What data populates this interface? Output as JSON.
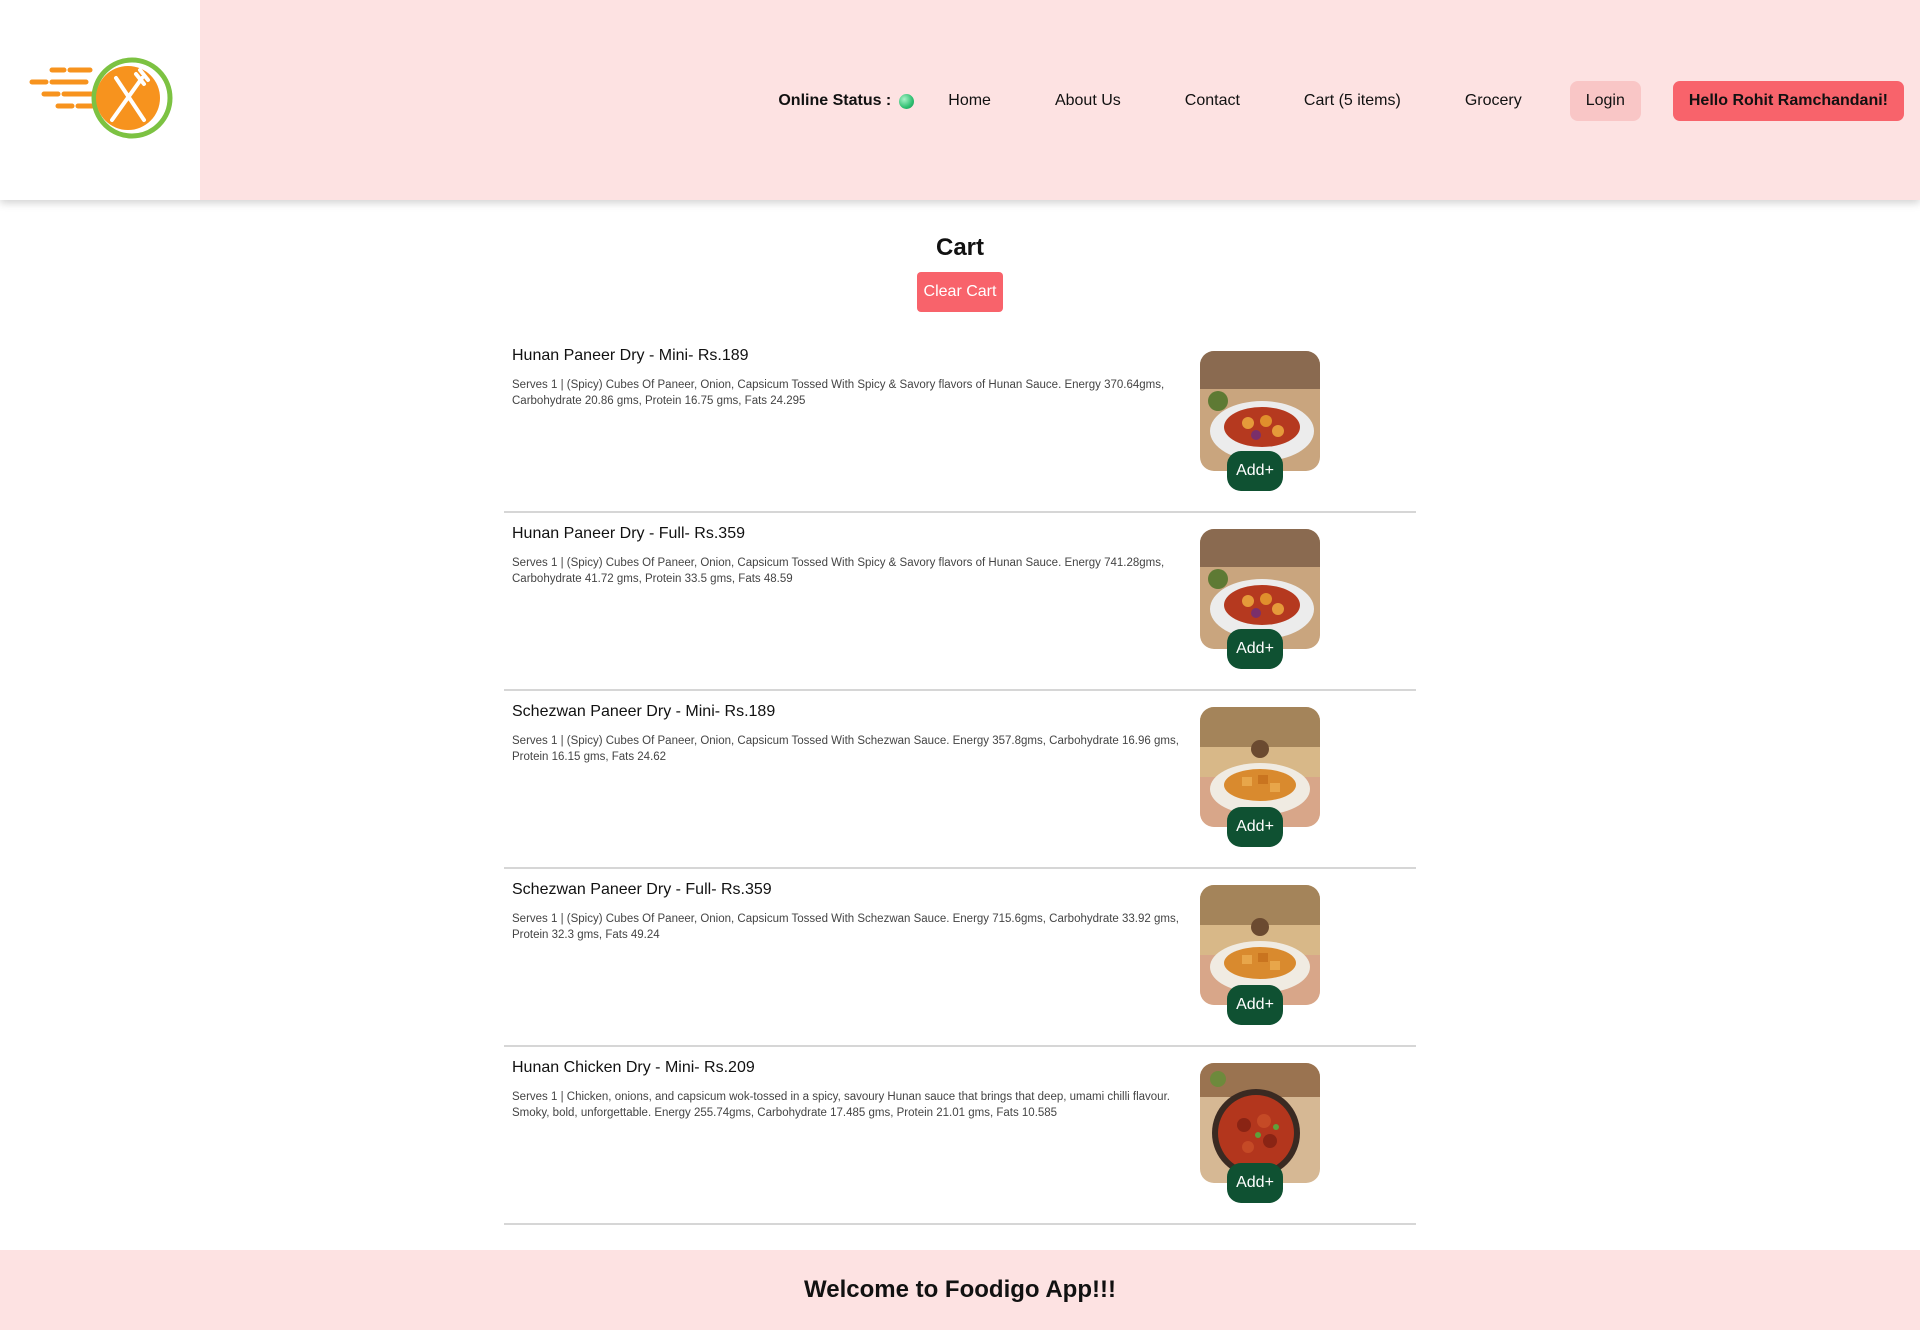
{
  "brand": {
    "logo_icon": "fork-knife-speed-logo",
    "accent": "#f7931e",
    "ring": "#7cc242"
  },
  "nav": {
    "status_label": "Online Status :",
    "status_color": "#2fbf71",
    "home": "Home",
    "about": "About Us",
    "contact": "Contact",
    "cart": "Cart (5 items)",
    "grocery": "Grocery",
    "login": "Login",
    "user_greeting": "Hello Rohit Ramchandani!"
  },
  "cart": {
    "title": "Cart",
    "clear_label": "Clear Cart",
    "items": [
      {
        "name": "Hunan Paneer Dry - Mini- Rs.189",
        "desc": "Serves 1 | (Spicy) Cubes Of Paneer, Onion, Capsicum Tossed With Spicy & Savory flavors of Hunan Sauce. Energy 370.64gms, Carbohydrate 20.86 gms, Protein 16.75 gms, Fats 24.295",
        "add_label": "Add+",
        "image": "hunan-paneer-dish"
      },
      {
        "name": "Hunan Paneer Dry - Full- Rs.359",
        "desc": "Serves 1 | (Spicy) Cubes Of Paneer, Onion, Capsicum Tossed With Spicy & Savory flavors of Hunan Sauce. Energy 741.28gms, Carbohydrate 41.72 gms, Protein 33.5 gms, Fats 48.59",
        "add_label": "Add+",
        "image": "hunan-paneer-dish"
      },
      {
        "name": "Schezwan Paneer Dry - Mini- Rs.189",
        "desc": "Serves 1 | (Spicy) Cubes Of Paneer, Onion, Capsicum Tossed With Schezwan Sauce. Energy 357.8gms, Carbohydrate 16.96 gms, Protein 16.15 gms, Fats 24.62",
        "add_label": "Add+",
        "image": "schezwan-paneer-dish"
      },
      {
        "name": "Schezwan Paneer Dry - Full- Rs.359",
        "desc": "Serves 1 | (Spicy) Cubes Of Paneer, Onion, Capsicum Tossed With Schezwan Sauce. Energy 715.6gms, Carbohydrate 33.92 gms, Protein 32.3 gms, Fats 49.24",
        "add_label": "Add+",
        "image": "schezwan-paneer-dish"
      },
      {
        "name": "Hunan Chicken Dry - Mini- Rs.209",
        "desc": "Serves 1 | Chicken, onions, and capsicum wok-tossed in a spicy, savoury Hunan sauce that brings that deep, umami chilli flavour. Smoky, bold, unforgettable. Energy 255.74gms, Carbohydrate 17.485 gms, Protein 21.01 gms, Fats 10.585",
        "add_label": "Add+",
        "image": "hunan-chicken-dish"
      }
    ]
  },
  "footer": {
    "text": "Welcome to Foodigo App!!!"
  }
}
